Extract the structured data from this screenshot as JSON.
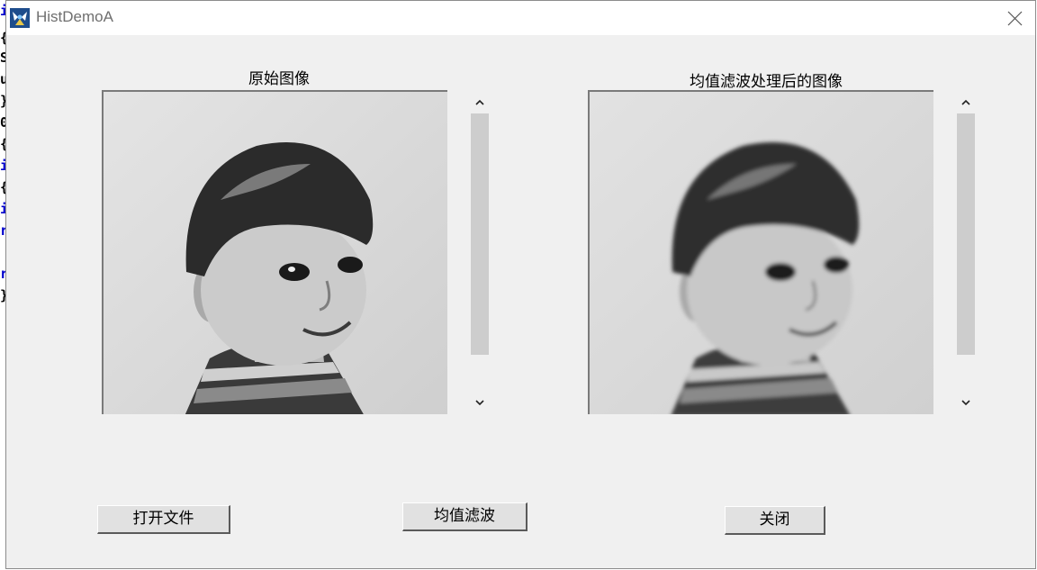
{
  "window": {
    "title": "HistDemoA"
  },
  "panels": {
    "original_caption": "原始图像",
    "filtered_caption": "均值滤波处理后的图像"
  },
  "buttons": {
    "open_file": "打开文件",
    "mean_filter": "均值滤波",
    "close": "关闭"
  },
  "background_code_chars": [
    "i",
    "{",
    "S",
    "u",
    "}",
    "0",
    "{",
    "i",
    "{",
    "i",
    "r",
    "r",
    "}"
  ],
  "colors": {
    "window_bg": "#f0f0f0",
    "titlebar_bg": "#ffffff",
    "title_text": "#6f6f6f",
    "scroll_thumb": "#cdcdcd",
    "code_blue": "#0000cc"
  },
  "icons": {
    "app": "app-icon",
    "close": "close-icon",
    "scroll_up": "chevron-up-icon",
    "scroll_down": "chevron-down-icon"
  }
}
